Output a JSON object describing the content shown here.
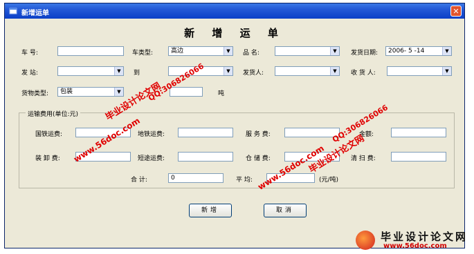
{
  "window": {
    "title": "新增运单",
    "close_glyph": "✕"
  },
  "form": {
    "heading": "新 增 运 单",
    "row1": {
      "car_no_label": "车    号:",
      "car_no_value": "",
      "car_type_label": "车类型:",
      "car_type_value": "高边",
      "product_label": "品  名:",
      "product_value": "",
      "date_label": "发货日期:",
      "date_value": "2006- 5 -14"
    },
    "row2": {
      "from_label": "发    站:",
      "from_value": "",
      "to_label": "到",
      "to_value": "",
      "sender_label": "发货人:",
      "sender_value": "",
      "receiver_label": "收 货 人:",
      "receiver_value": ""
    },
    "row3": {
      "cargo_type_label": "货物类型:",
      "cargo_type_value": "包装",
      "weight_value": "",
      "weight_unit": "吨"
    },
    "fees": {
      "group_title": "运输费用(单位:元)",
      "national_rail_label": "国铁运费:",
      "national_rail_value": "",
      "local_rail_label": "地铁运费:",
      "local_rail_value": "",
      "service_label": "服 务 费:",
      "service_value": "",
      "amount_label": "金额:",
      "amount_value": "",
      "loading_label": "装 卸 费:",
      "loading_value": "",
      "short_haul_label": "短途运费:",
      "short_haul_value": "",
      "storage_label": "仓 储 费:",
      "storage_value": "",
      "cleaning_label": "清 扫 费:",
      "cleaning_value": "",
      "total_label": "合    计:",
      "total_value": "0",
      "average_label": "平    均:",
      "average_value": "",
      "average_unit": "(元/吨)"
    },
    "buttons": {
      "add": "新增",
      "cancel": "取消"
    }
  },
  "watermarks": {
    "site_a": "毕业设计论文网",
    "qq_a": "QQ:306826066",
    "url_a": "www.56doc.com",
    "qq_b": "QQ:306826066",
    "site_b": "毕业设计论文网",
    "url_b": "www.56doc.com"
  },
  "logo": {
    "title": "毕业设计论文网",
    "url": "www.56doc.com"
  },
  "icons": {
    "app": "window-icon",
    "dropdown": "chevron-down-icon",
    "close": "close-icon"
  },
  "colors": {
    "titlebar": "#0b3fc7",
    "window_bg": "#ece9d8",
    "watermark": "#e00000"
  }
}
